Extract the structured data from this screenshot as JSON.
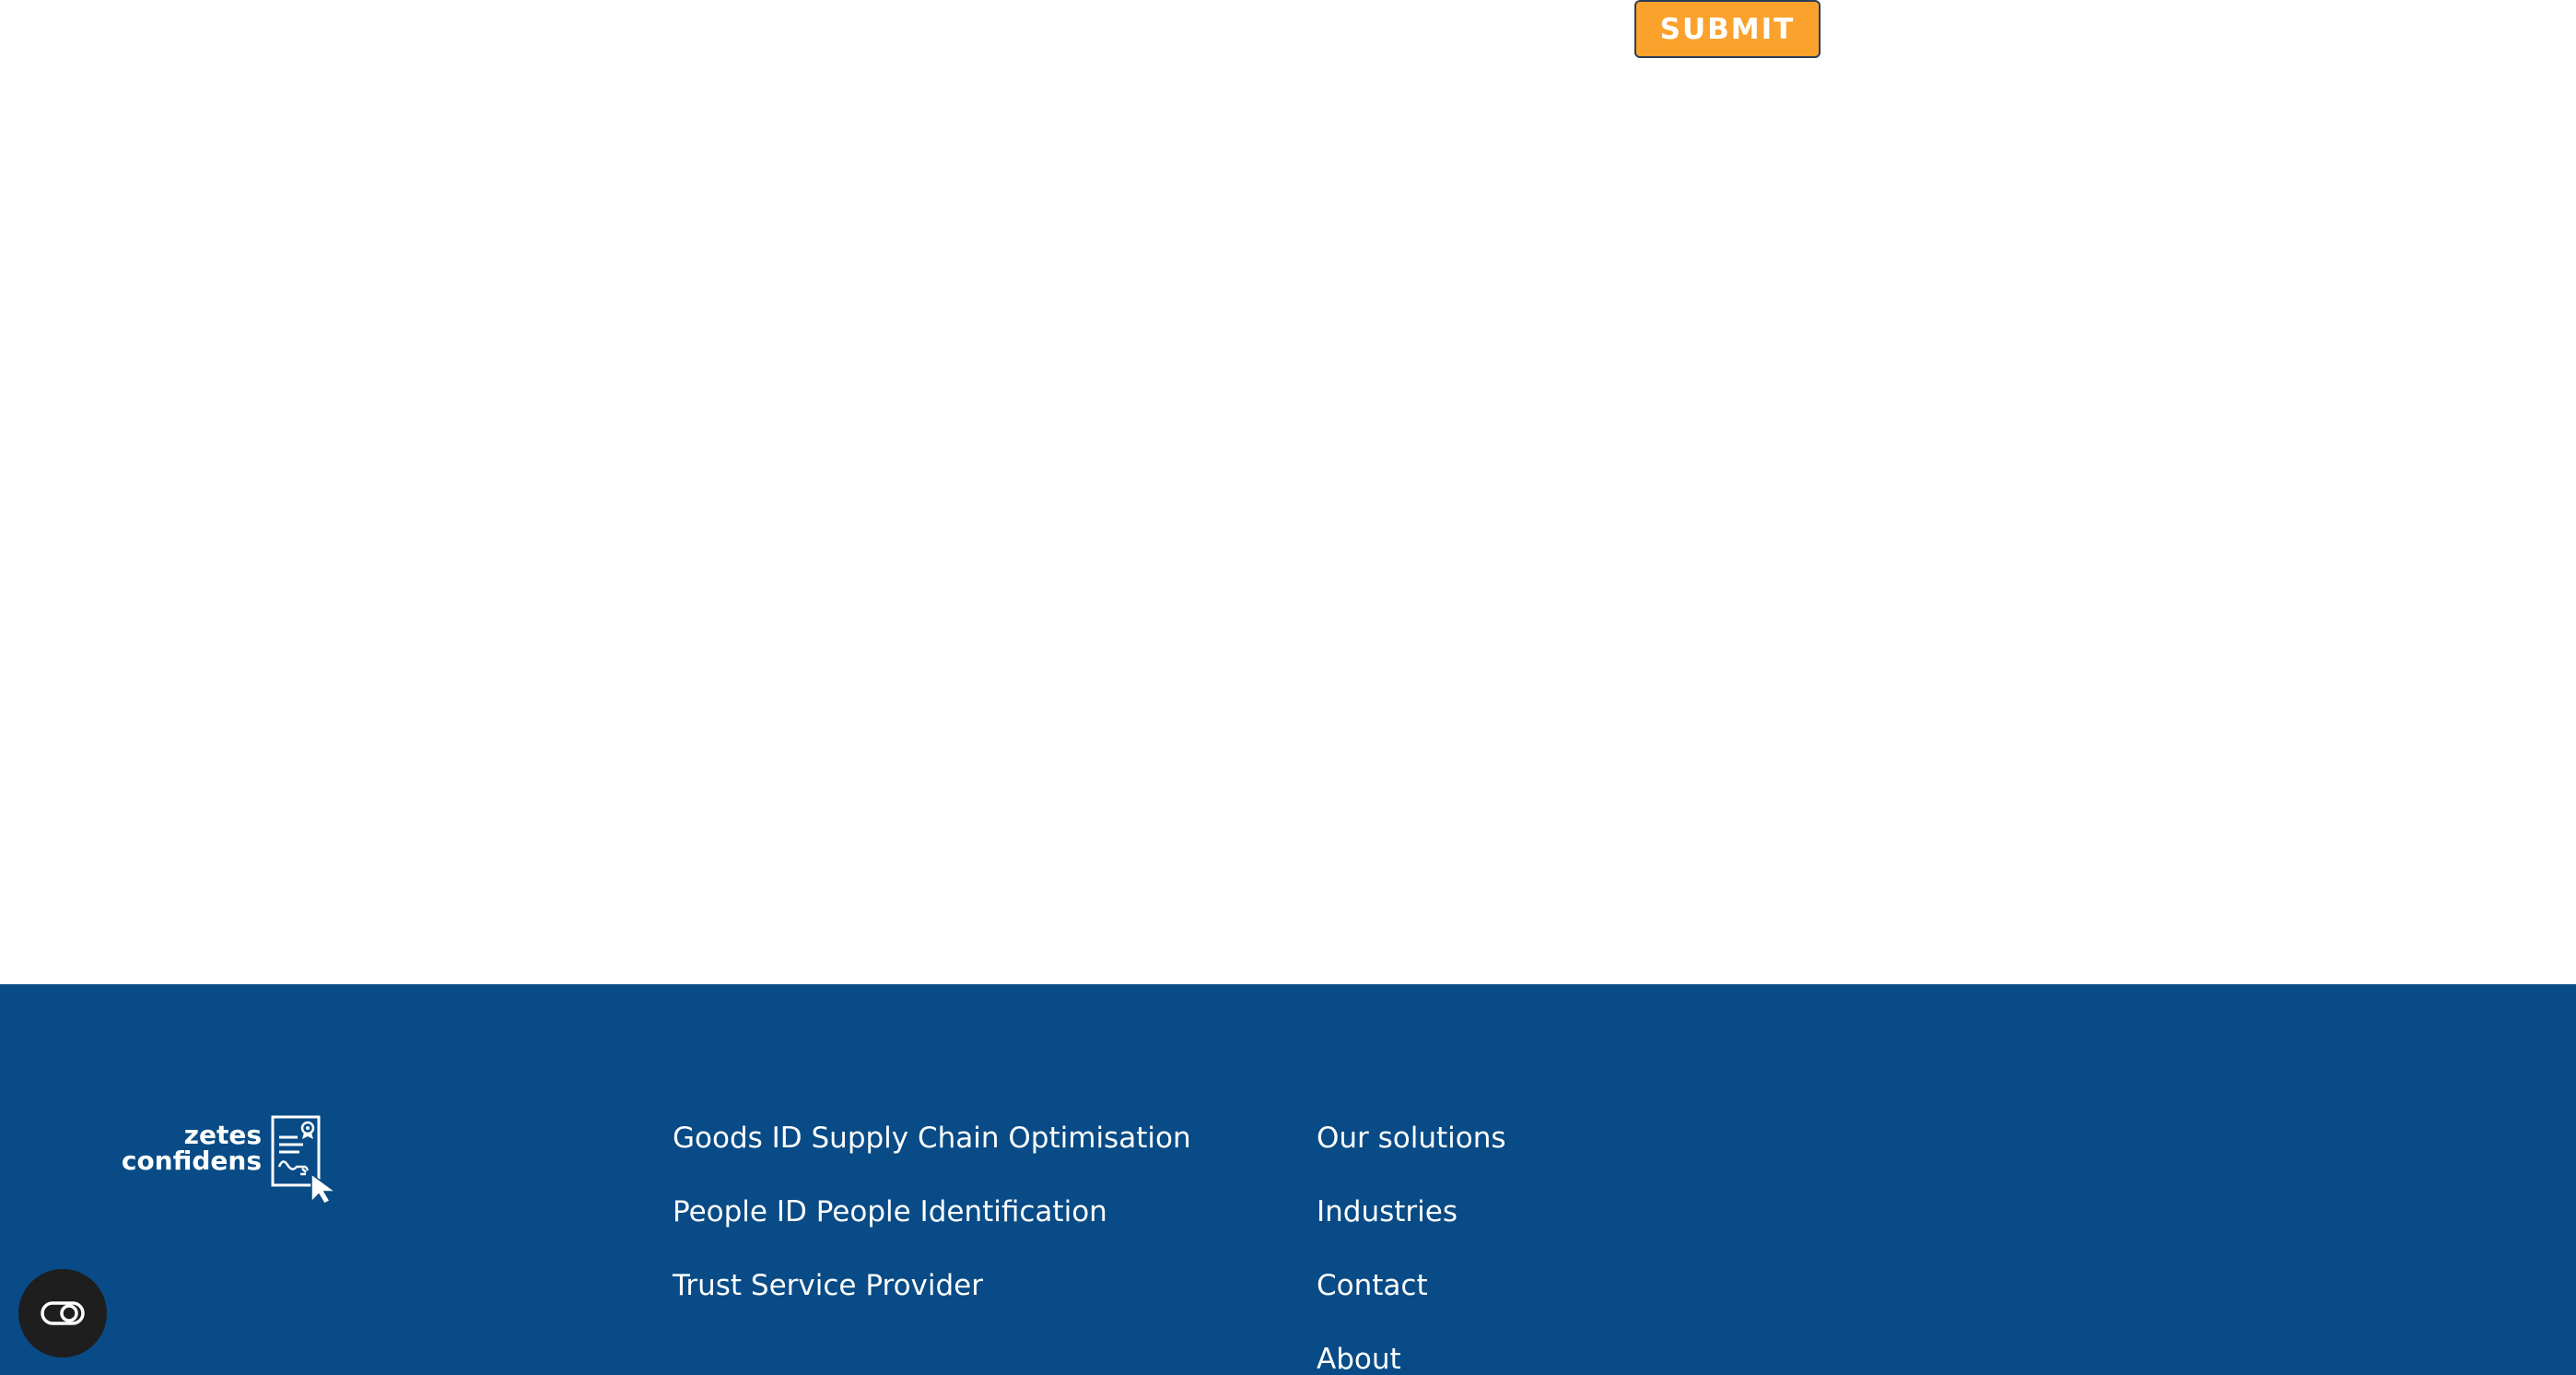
{
  "form": {
    "submit_label": "SUBMIT"
  },
  "footer": {
    "logo": {
      "line1": "zetes",
      "line2": "confidens"
    },
    "column1": [
      {
        "label": "Goods ID Supply Chain Optimisation"
      },
      {
        "label": "People ID People Identification"
      },
      {
        "label": "Trust Service Provider"
      }
    ],
    "column2": [
      {
        "label": "Our solutions"
      },
      {
        "label": "Industries"
      },
      {
        "label": "Contact"
      },
      {
        "label": "About"
      }
    ]
  },
  "accessibility": {
    "icon": "accessibility-toggle-icon"
  },
  "colors": {
    "footer_bg": "#084b86",
    "submit_bg": "#fba22d",
    "submit_border": "#2c3d57",
    "a11y_bg": "#1e1e1e"
  }
}
